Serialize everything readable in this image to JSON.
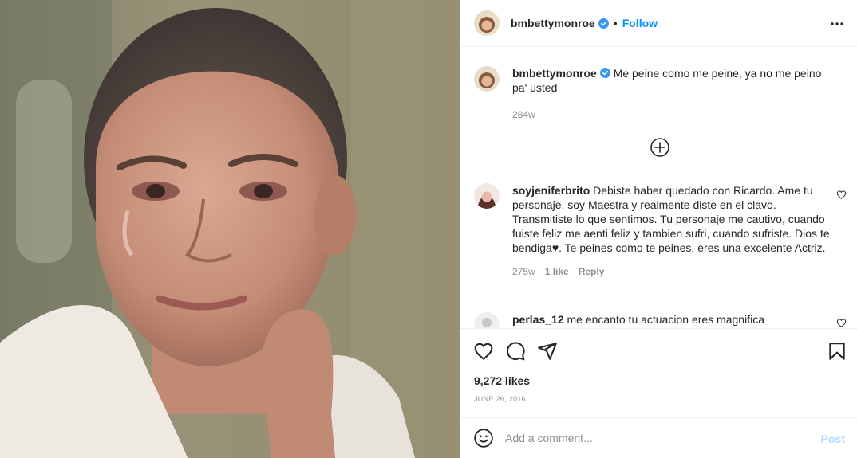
{
  "post": {
    "username": "bmbettymonroe",
    "follow_label": "Follow",
    "dot": "•",
    "caption": {
      "username": "bmbettymonroe",
      "text": "Me peine como me peine, ya no me peino pa' usted",
      "age": "284w"
    },
    "comments": [
      {
        "username": "soyjeniferbrito",
        "text": "Debiste haber quedado con Ricardo. Ame tu personaje, soy Maestra y realmente diste en el clavo. Transmitiste lo que sentimos. Tu personaje me cautivo, cuando fuiste feliz me aenti feliz y tambien sufri, cuando sufriste. Dios te bendiga♥. Te peines como te peines, eres una excelente Actriz.",
        "age": "275w",
        "likes": "1 like",
        "reply_label": "Reply"
      },
      {
        "username": "perlas_12",
        "text": "me encanto tu actuacion eres magnifica"
      }
    ],
    "likes_text": "9,272 likes",
    "date": "JUNE 26, 2016",
    "comment_placeholder": "Add a comment...",
    "post_label": "Post"
  },
  "colors": {
    "accent": "#0095f6",
    "post_disabled": "#b3dbff",
    "muted": "#8e8e8e",
    "text": "#262626"
  },
  "icons": [
    "verified-badge-icon",
    "more-options-icon",
    "load-more-comments-icon",
    "heart-icon",
    "comment-icon",
    "share-icon",
    "bookmark-icon",
    "emoji-icon"
  ]
}
